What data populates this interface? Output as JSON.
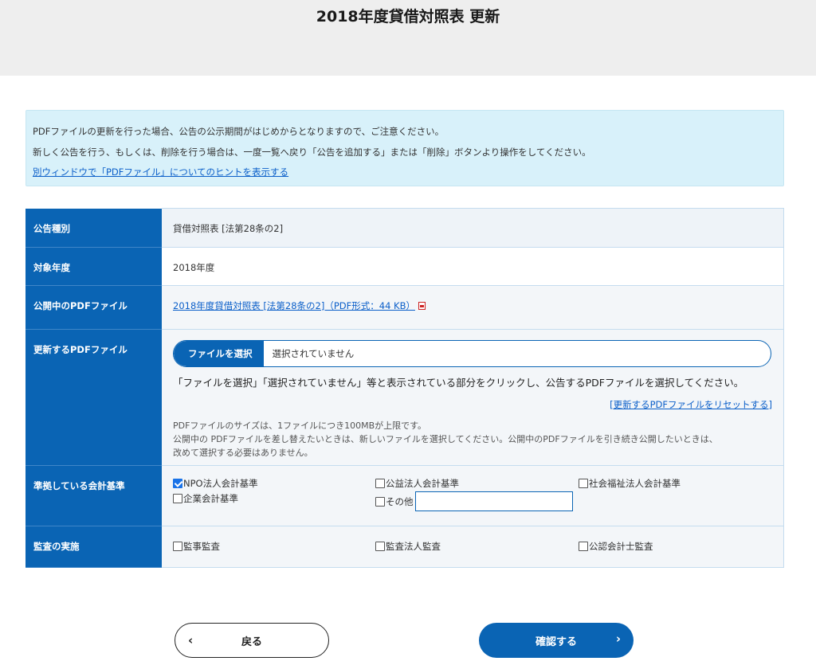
{
  "page": {
    "title": "2018年度貸借対照表 更新"
  },
  "notice": {
    "line1": "PDFファイルの更新を行った場合、公告の公示期間がはじめからとなりますので、ご注意ください。",
    "line2": "新しく公告を行う、もしくは、削除を行う場合は、一度一覧へ戻り「公告を追加する」または「削除」ボタンより操作をしてください。",
    "hint_link": "別ウィンドウで「PDFファイル」についてのヒントを表示する"
  },
  "form": {
    "type_label": "公告種別",
    "type_value": "貸借対照表 [法第28条の2]",
    "year_label": "対象年度",
    "year_value": "2018年度",
    "public_pdf_label": "公開中のPDFファイル",
    "public_pdf_link": "2018年度貸借対照表 [法第28条の2]（PDF形式：44 KB）",
    "update_pdf_label": "更新するPDFファイル",
    "file_button": "ファイルを選択",
    "file_status": "選択されていません",
    "file_hint": "「ファイルを選択」「選択されていません」等と表示されている部分をクリックし、公告するPDFファイルを選択してください。",
    "reset_link": "[更新するPDFファイルをリセットする]",
    "size_note_1": "PDFファイルのサイズは、1ファイルにつき100MBが上限です。",
    "size_note_2": "公開中の PDFファイルを差し替えたいときは、新しいファイルを選択してください。公開中のPDFファイルを引き続き公開したいときは、",
    "size_note_3": "改めて選択する必要はありません。",
    "standards_label": "準拠している会計基準",
    "standards": [
      {
        "label": "NPO法人会計基準",
        "checked": true
      },
      {
        "label": "公益法人会計基準",
        "checked": false
      },
      {
        "label": "社会福祉法人会計基準",
        "checked": false
      },
      {
        "label": "企業会計基準",
        "checked": false
      },
      {
        "label": "その他",
        "checked": false
      }
    ],
    "audit_label": "監査の実施",
    "audits": [
      {
        "label": "監事監査",
        "checked": false
      },
      {
        "label": "監査法人監査",
        "checked": false
      },
      {
        "label": "公認会計士監査",
        "checked": false
      }
    ]
  },
  "buttons": {
    "back": "戻る",
    "confirm": "確認する",
    "back_icon": "chevron-left-icon",
    "confirm_icon": "chevron-right-icon"
  },
  "colors": {
    "primary": "#0a64b4",
    "notice_bg": "#d8f1fa",
    "link": "#0b5fc9"
  }
}
